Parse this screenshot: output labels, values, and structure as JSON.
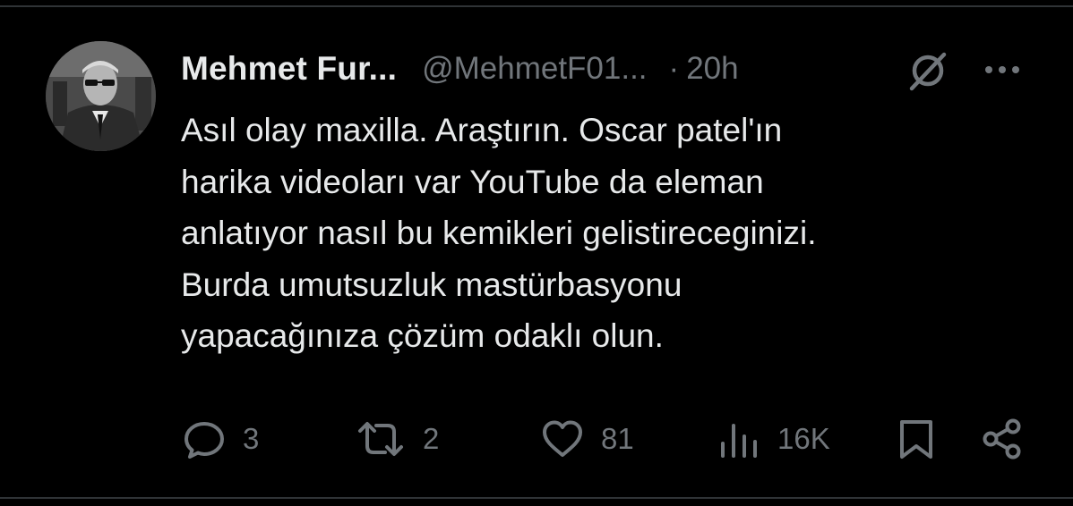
{
  "tweet": {
    "display_name": "Mehmet Fur...",
    "handle": "@MehmetF01...",
    "separator": "·",
    "time": "20h",
    "text_lines": [
      "Asıl olay maxilla. Araştırın. Oscar patel'ın",
      "harika videoları var YouTube da eleman",
      "anlatıyor nasıl bu kemikleri gelistireceginizi.",
      "Burda umutsuzluk mastürbasyonu",
      "yapacağınıza çözüm odaklı olun."
    ]
  },
  "header_icons": {
    "grok": "grok-icon",
    "more": "more-icon"
  },
  "actions": {
    "reply": {
      "icon": "reply-icon",
      "count": "3"
    },
    "repost": {
      "icon": "repost-icon",
      "count": "2"
    },
    "like": {
      "icon": "like-icon",
      "count": "81"
    },
    "views": {
      "icon": "views-icon",
      "count": "16K"
    },
    "bookmark": {
      "icon": "bookmark-icon"
    },
    "share": {
      "icon": "share-icon"
    }
  },
  "colors": {
    "background": "#000000",
    "text_primary": "#e7e9ea",
    "text_secondary": "#71767b",
    "divider": "#2f3336"
  }
}
